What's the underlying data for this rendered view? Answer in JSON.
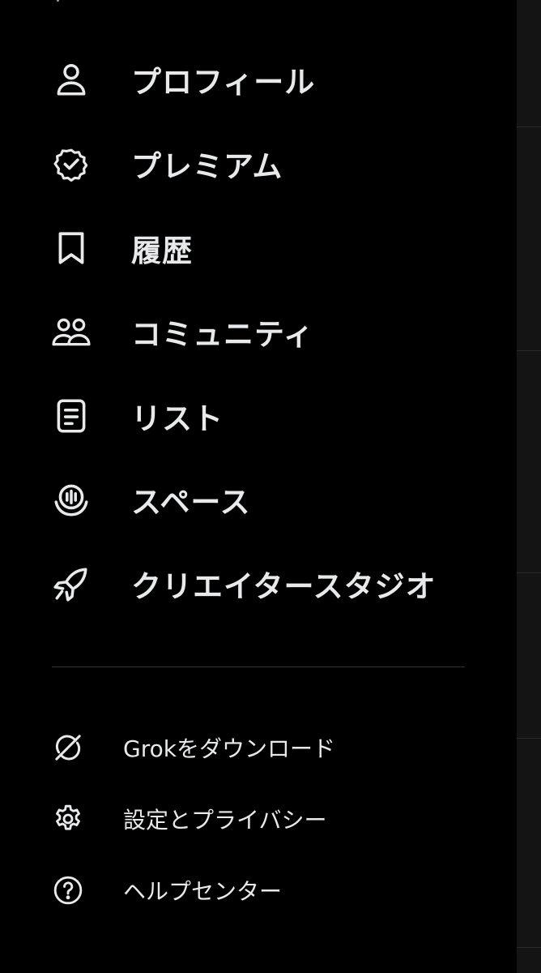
{
  "menu": {
    "items": [
      {
        "label": "プロフィール",
        "icon": "profile-icon"
      },
      {
        "label": "プレミアム",
        "icon": "verified-badge-icon"
      },
      {
        "label": "履歴",
        "icon": "bookmark-icon"
      },
      {
        "label": "コミュニティ",
        "icon": "communities-icon"
      },
      {
        "label": "リスト",
        "icon": "lists-icon"
      },
      {
        "label": "スペース",
        "icon": "spaces-icon"
      },
      {
        "label": "クリエイタースタジオ",
        "icon": "rocket-icon"
      }
    ]
  },
  "secondary": {
    "items": [
      {
        "label": "Grokをダウンロード",
        "icon": "grok-icon"
      },
      {
        "label": "設定とプライバシー",
        "icon": "gear-icon"
      },
      {
        "label": "ヘルプセンター",
        "icon": "help-icon"
      }
    ]
  },
  "colors": {
    "background": "#000000",
    "text": "#e7e9ea",
    "divider": "#2f3336",
    "backdrop": "#141414"
  }
}
